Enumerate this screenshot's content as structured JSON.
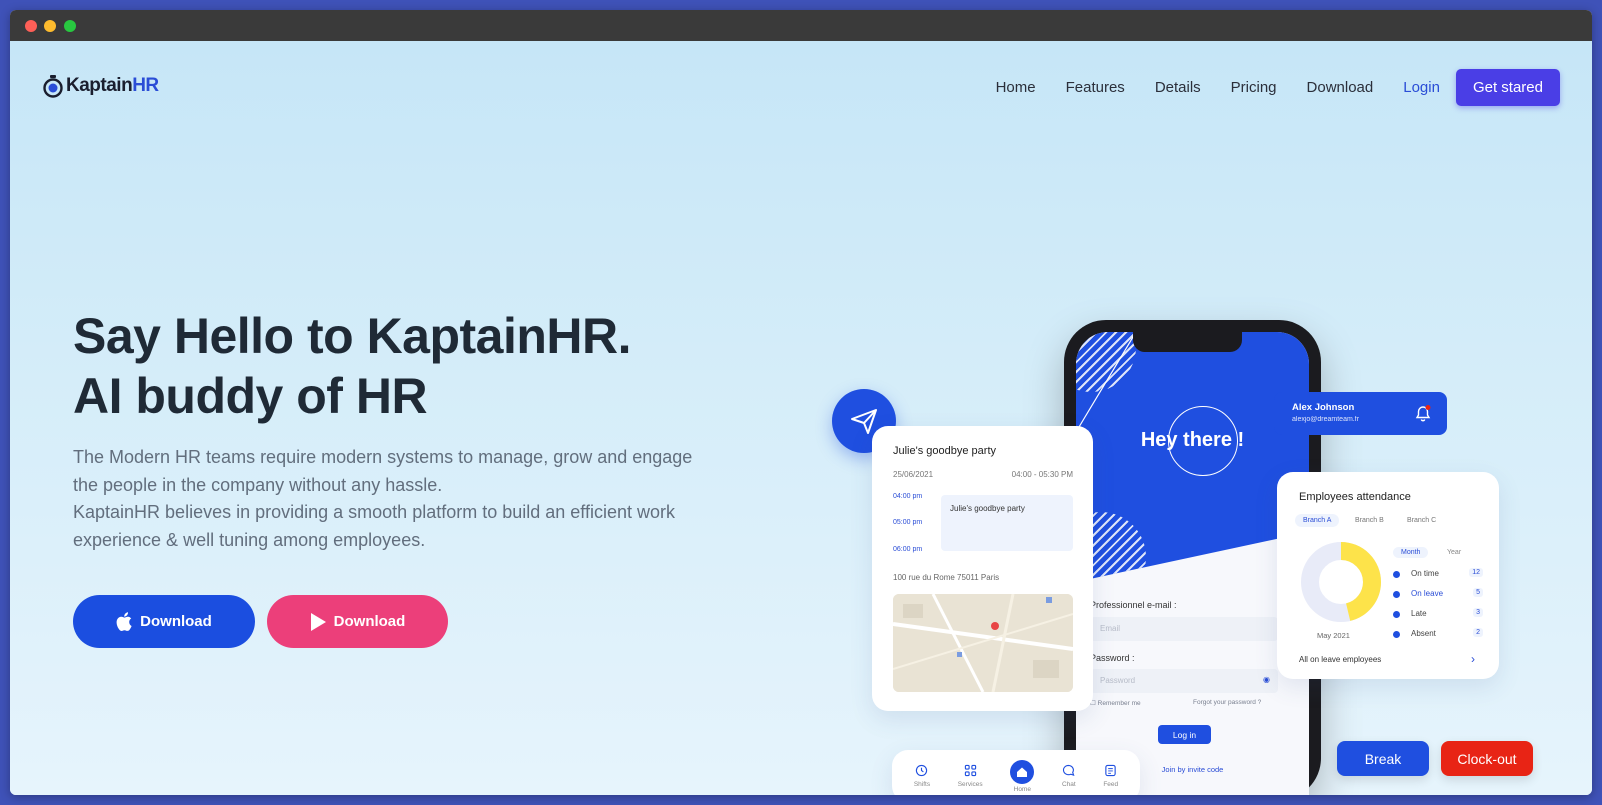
{
  "nav": {
    "logo_prefix": "Kaptain",
    "logo_suffix": "HR",
    "links": [
      "Home",
      "Features",
      "Details",
      "Pricing",
      "Download"
    ],
    "login": "Login",
    "cta": "Get stared"
  },
  "hero": {
    "title_line1": "Say Hello to KaptainHR.",
    "title_line2": "AI buddy of HR",
    "desc_line1": "The Modern HR teams require modern systems to manage, grow and engage",
    "desc_line2": "the people in the company without any hassle.",
    "desc_line3": "KaptainHR believes in providing a smooth platform to build an efficient work",
    "desc_line4": "experience & well tuning among employees.",
    "btn_apple": "Download",
    "btn_play": "Download"
  },
  "phone": {
    "greeting": "Hey there !",
    "email_label": "Professionnel e-mail :",
    "email_placeholder": "Email",
    "password_label": "Password :",
    "password_placeholder": "Password",
    "remember": "Remember me",
    "forgot": "Forgot your password ?",
    "login_btn": "Log in",
    "invite": "Join by invite code"
  },
  "event": {
    "title": "Julie's goodbye party",
    "date": "25/06/2021",
    "time": "04:00 - 05:30 PM",
    "slots": [
      "04:00 pm",
      "05:00 pm",
      "06:00 pm"
    ],
    "block": "Julie's goodbye party",
    "address": "100 rue du Rome 75011 Paris"
  },
  "tabbar": {
    "tabs": [
      "Shifts",
      "Services",
      "Home",
      "Chat",
      "Feed"
    ]
  },
  "user": {
    "name": "Alex Johnson",
    "email": "alexjo@dreamteam.fr"
  },
  "attendance": {
    "title": "Employees attendance",
    "branches": [
      "Branch A",
      "Branch B",
      "Branch C"
    ],
    "periods": [
      "Month",
      "Year"
    ],
    "caption": "May 2021",
    "legend": [
      {
        "label": "On time",
        "count": "12"
      },
      {
        "label": "On leave",
        "count": "5"
      },
      {
        "label": "Late",
        "count": "3"
      },
      {
        "label": "Absent",
        "count": "2"
      }
    ],
    "footer": "All on leave employees"
  },
  "actions": {
    "break": "Break",
    "clockout": "Clock-out"
  },
  "colors": {
    "primary": "#1f4fe0",
    "accent_purple": "#4a3ee6",
    "pink": "#ec3f7a",
    "red": "#e82415",
    "donut_yellow": "#fde34a"
  }
}
